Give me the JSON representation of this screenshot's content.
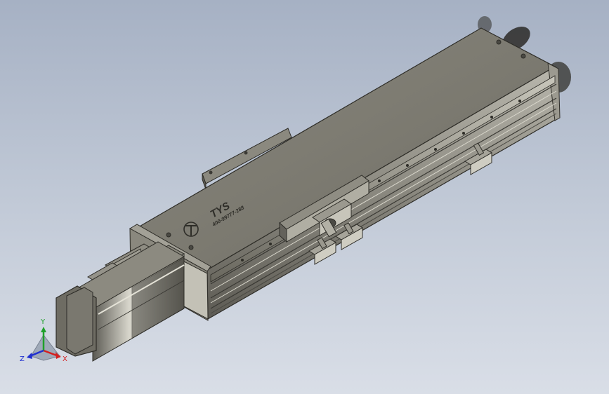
{
  "viewport": {
    "background_top": "#a6b1c4",
    "background_bottom": "#d9dee7"
  },
  "model": {
    "brand": "TYS",
    "phone": "400-99777-288",
    "body_color": "#7d7b71",
    "edge_color": "#2e2d28"
  },
  "triad": {
    "x_label": "X",
    "y_label": "Y",
    "z_label": "Z",
    "x_color": "#d42020",
    "y_color": "#1fa02a",
    "z_color": "#2030d0"
  }
}
